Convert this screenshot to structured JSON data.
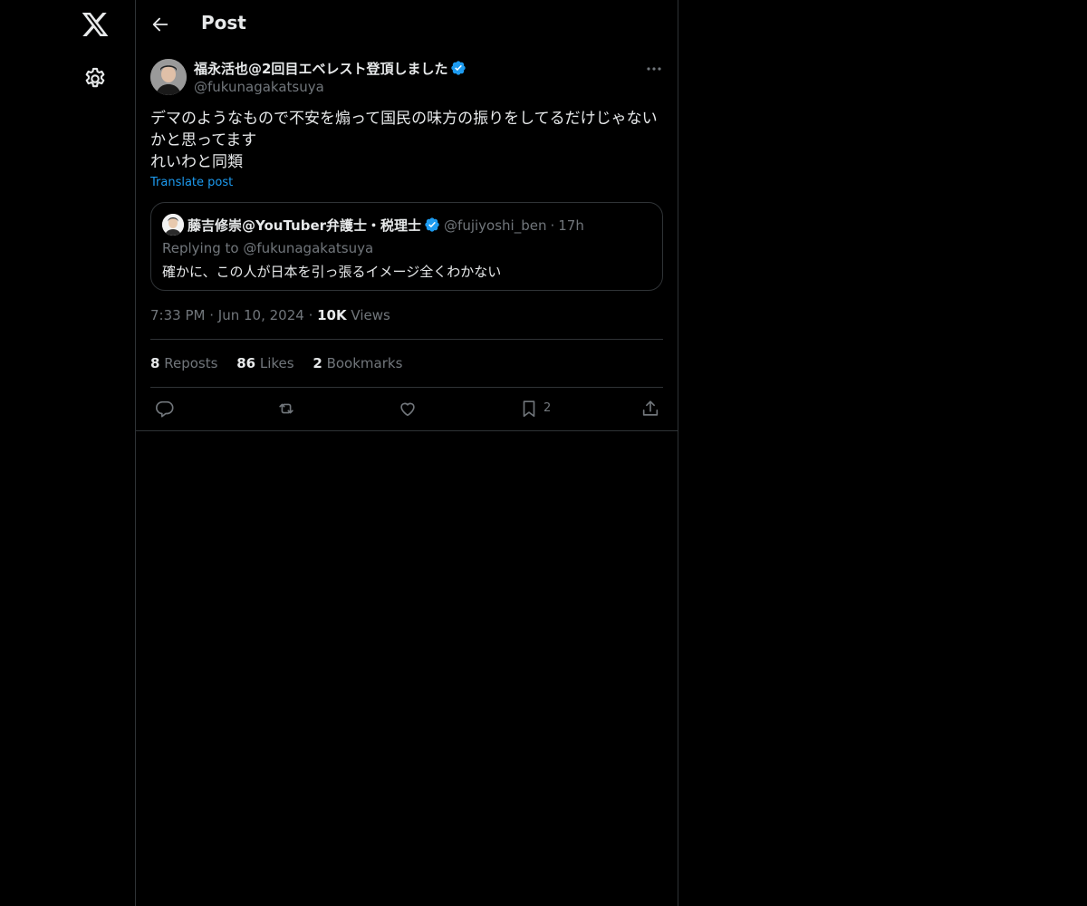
{
  "header": {
    "title": "Post"
  },
  "post": {
    "author_name": "福永活也@2回目エベレスト登頂しました",
    "handle": "@fukunagakatsuya",
    "text": "デマのようなもので不安を煽って国民の味方の振りをしてるだけじゃないかと思ってます\nれいわと同類",
    "translate_label": "Translate post",
    "time": "7:33 PM",
    "date": "Jun 10, 2024",
    "views_count": "10K",
    "views_label": "Views"
  },
  "quote": {
    "author_name": "藤吉修崇@YouTuber弁護士・税理士",
    "handle": "@fujiyoshi_ben",
    "age": "17h",
    "replying_to": "Replying to @fukunagakatsuya",
    "text": "確かに、この人が日本を引っ張るイメージ全くわかない"
  },
  "stats": {
    "reposts_count": "8",
    "reposts_label": "Reposts",
    "likes_count": "86",
    "likes_label": "Likes",
    "bookmarks_count": "2",
    "bookmarks_label": "Bookmarks"
  },
  "actions": {
    "bookmark_count": "2"
  },
  "colors": {
    "accent": "#1d9bf0",
    "background": "#000000",
    "border": "#2f3336",
    "muted": "#71767b"
  }
}
